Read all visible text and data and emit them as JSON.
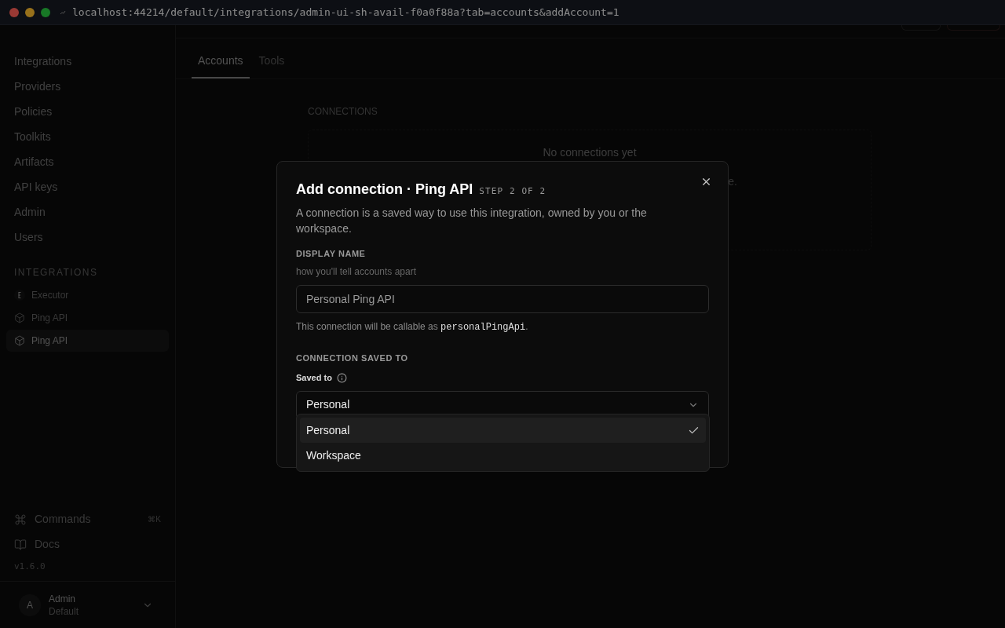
{
  "browser": {
    "url": "localhost:44214/default/integrations/admin-ui-sh-avail-f0a0f88a?tab=accounts&addAccount=1"
  },
  "sidebar": {
    "nav": [
      {
        "label": "Integrations"
      },
      {
        "label": "Providers"
      },
      {
        "label": "Policies"
      },
      {
        "label": "Toolkits"
      },
      {
        "label": "Artifacts"
      },
      {
        "label": "API keys"
      },
      {
        "label": "Admin"
      },
      {
        "label": "Users"
      }
    ],
    "section_title": "INTEGRATIONS",
    "integrations": [
      {
        "kind": "executor",
        "label": "Executor",
        "selected": false
      },
      {
        "kind": "package",
        "label": "Ping API",
        "selected": false
      },
      {
        "kind": "package",
        "label": "Ping API",
        "selected": true
      }
    ],
    "commands": {
      "label": "Commands",
      "shortcut": "⌘K"
    },
    "docs": {
      "label": "Docs"
    },
    "version": "v1.6.0",
    "user": {
      "initial": "A",
      "name": "Admin",
      "workspace": "Default"
    }
  },
  "tabs": [
    {
      "label": "Accounts",
      "selected": true
    },
    {
      "label": "Tools",
      "selected": false
    }
  ],
  "connections": {
    "title": "CONNECTIONS",
    "empty_title": "No connections yet",
    "empty_text_fragment": "e."
  },
  "dialog": {
    "title": "Add connection · Ping API",
    "step": "STEP 2 OF 2",
    "description": "A connection is a saved way to use this integration, owned by you or the workspace.",
    "display_name": {
      "label": "DISPLAY NAME",
      "hint": "how you'll tell accounts apart",
      "value": "Personal Ping API",
      "callable_prefix": "This connection will be callable as ",
      "callable_name": "personalPingApi",
      "callable_suffix": "."
    },
    "saved_to": {
      "section": "CONNECTION SAVED TO",
      "label": "Saved to",
      "value": "Personal",
      "options": [
        {
          "label": "Personal",
          "selected": true
        },
        {
          "label": "Workspace",
          "selected": false
        }
      ]
    }
  }
}
